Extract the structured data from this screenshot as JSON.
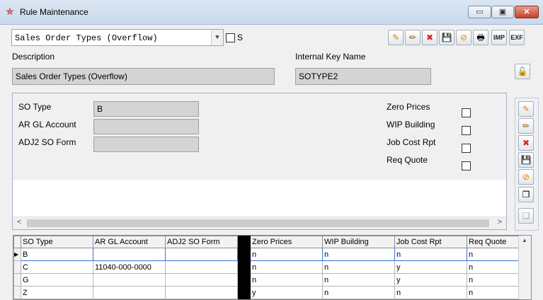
{
  "window": {
    "title": "Rule Maintenance",
    "app_icon": "star-icon",
    "min_label": "▭",
    "max_label": "▣",
    "close_label": "✕"
  },
  "selector": {
    "value": "Sales Order Types (Overflow)",
    "checkbox_label": "S"
  },
  "toolbar": {
    "new": "✎",
    "edit": "✏",
    "delete": "✖",
    "save": "💾",
    "cancel": "⊘",
    "print": "🖶",
    "imp_label": "IMP",
    "exp_label": "EXF"
  },
  "description": {
    "label": "Description",
    "value": "Sales Order Types (Overflow)"
  },
  "internal_key": {
    "label": "Internal Key Name",
    "value": "SOTYPE2"
  },
  "lock_icon": "🔓",
  "form": {
    "so_type": {
      "label": "SO Type",
      "value": "B"
    },
    "ar_gl_account": {
      "label": "AR GL Account",
      "value": ""
    },
    "adj2_so_form": {
      "label": "ADJ2 SO Form",
      "value": ""
    },
    "zero_prices": {
      "label": "Zero Prices"
    },
    "wip_building": {
      "label": "WIP Building"
    },
    "job_cost_rpt": {
      "label": "Job Cost Rpt"
    },
    "req_quote": {
      "label": "Req Quote"
    }
  },
  "scroll": {
    "left": "<",
    "right": ">",
    "up": "▲"
  },
  "grid": {
    "columns": [
      "SO Type",
      "AR GL Account",
      "ADJ2 SO Form",
      "Zero Prices",
      "WIP Building",
      "Job Cost Rpt",
      "Req Quote"
    ],
    "current_row_marker": "▶",
    "rows": [
      [
        "B",
        "",
        "",
        "n",
        "n",
        "n",
        "n"
      ],
      [
        "C",
        "11040-000-0000",
        "",
        "n",
        "n",
        "y",
        "n"
      ],
      [
        "G",
        "",
        "",
        "n",
        "n",
        "y",
        "n"
      ],
      [
        "Z",
        "",
        "",
        "y",
        "n",
        "n",
        "n"
      ]
    ]
  }
}
